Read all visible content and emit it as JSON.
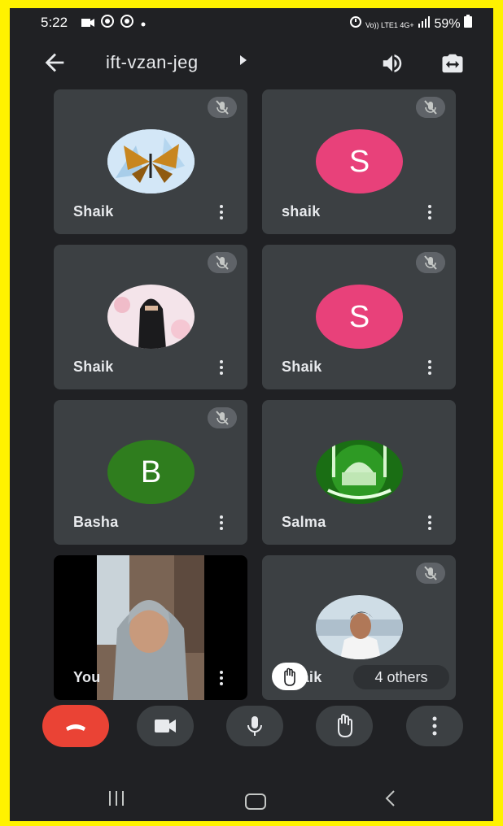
{
  "status_bar": {
    "time": "5:22",
    "notification_icons": [
      "video-icon",
      "chrome-icon",
      "chrome-icon",
      "dot-icon"
    ],
    "network_labels": "Vo)) LTE1 4G+",
    "battery": "59%"
  },
  "meeting": {
    "code": "ift-vzan-jeg"
  },
  "participants": [
    {
      "name": "Shaik",
      "avatar": "butterfly-photo",
      "muted": true
    },
    {
      "name": "shaik",
      "avatar_letter": "S",
      "avatar_color": "#e8417a",
      "muted": true
    },
    {
      "name": "Shaik",
      "avatar": "hijab-photo",
      "muted": true
    },
    {
      "name": "Shaik",
      "avatar_letter": "S",
      "avatar_color": "#e8417a",
      "muted": true
    },
    {
      "name": "Basha",
      "avatar_letter": "B",
      "avatar_color": "#2f7d1e",
      "muted": true
    },
    {
      "name": "Salma",
      "avatar": "mosque-photo",
      "muted": false
    },
    {
      "name": "You",
      "avatar": "self-video",
      "muted": false
    },
    {
      "name": "Shaik",
      "avatar": "man-photo",
      "muted": true,
      "hand_raised": true
    }
  ],
  "others_label": "4 others",
  "colors": {
    "background": "#202124",
    "tile": "#3c4043",
    "end_call": "#ea4335",
    "frame": "#fff200"
  },
  "controls": [
    "end-call-icon",
    "camera-icon",
    "microphone-icon",
    "raise-hand-icon",
    "more-icon"
  ]
}
